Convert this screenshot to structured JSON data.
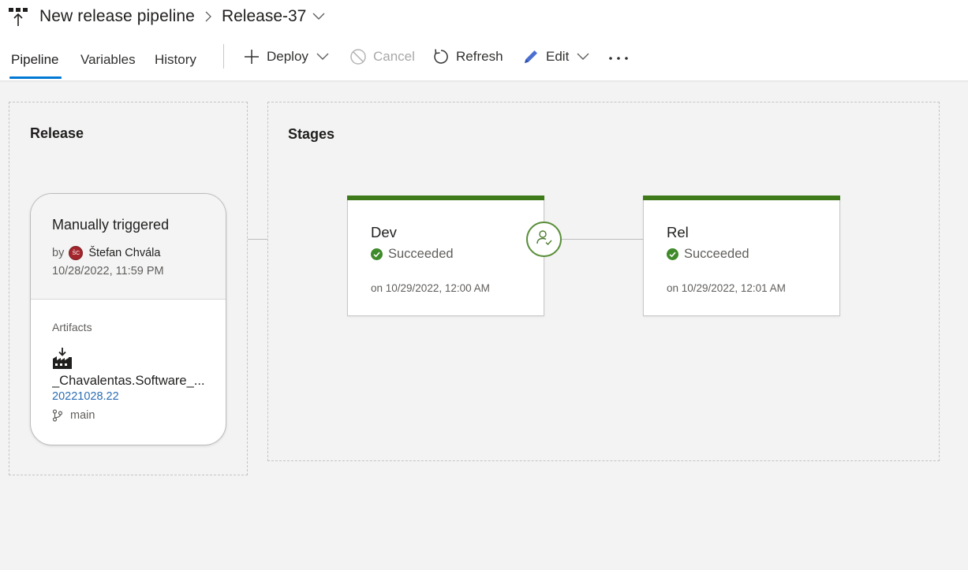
{
  "header": {
    "pipeline_name": "New release pipeline",
    "release_name": "Release-37"
  },
  "tabs": [
    {
      "label": "Pipeline",
      "active": true
    },
    {
      "label": "Variables",
      "active": false
    },
    {
      "label": "History",
      "active": false
    }
  ],
  "toolbar": {
    "deploy": "Deploy",
    "cancel": "Cancel",
    "refresh": "Refresh",
    "edit": "Edit"
  },
  "release_section": {
    "title": "Release",
    "trigger": "Manually triggered",
    "by_label": "by",
    "user_initials": "ŠC",
    "user_name": "Štefan Chvála",
    "date": "10/28/2022, 11:59 PM",
    "artifacts_label": "Artifacts",
    "artifact_name": "_Chavalentas.Software_...",
    "artifact_build": "20221028.22",
    "artifact_branch": "main"
  },
  "stages_section": {
    "title": "Stages",
    "stages": [
      {
        "name": "Dev",
        "status": "Succeeded",
        "date": "on 10/29/2022, 12:00 AM"
      },
      {
        "name": "Rel",
        "status": "Succeeded",
        "date": "on 10/29/2022, 12:01 AM"
      }
    ]
  },
  "colors": {
    "accent": "#0078d4",
    "success": "#3f7a1a",
    "link": "#2a6db5",
    "avatar": "#a4262c"
  }
}
